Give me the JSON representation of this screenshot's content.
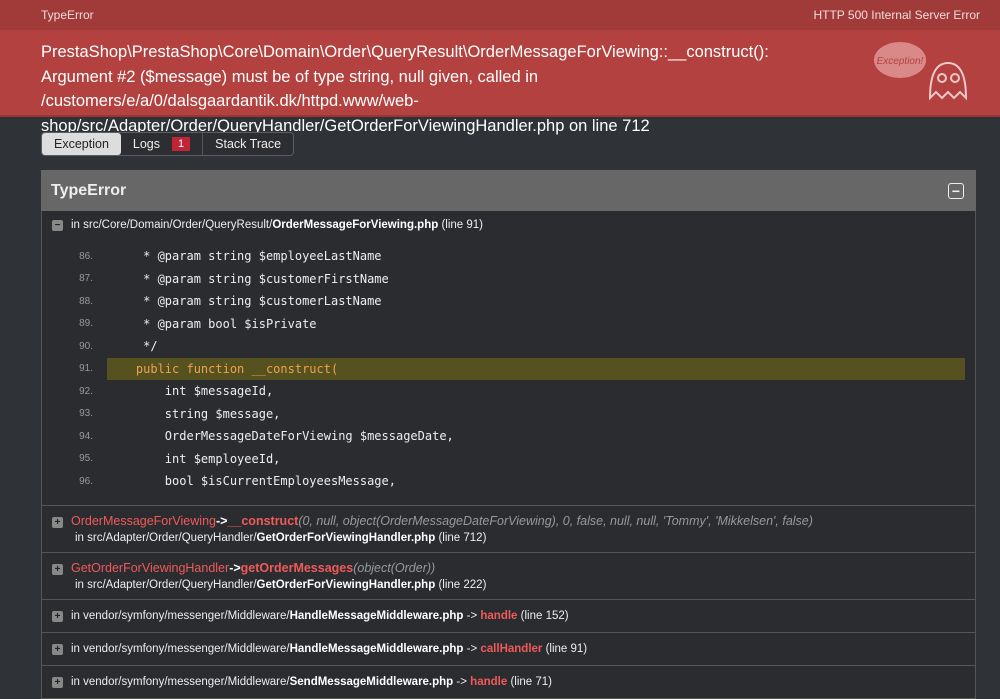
{
  "header": {
    "exception_class": "TypeError",
    "status": "HTTP 500",
    "status_text": "Internal Server Error"
  },
  "message": "PrestaShop\\PrestaShop\\Core\\Domain\\Order\\QueryResult\\OrderMessageForViewing::__construct(): Argument #2 ($message) must be of type string, null given, called in /customers/e/a/0/dalsgaardantik.dk/httpd.www/web-shop/src/Adapter/Order/QueryHandler/GetOrderForViewingHandler.php on line 712",
  "logo_text": "Exception!",
  "tabs": [
    {
      "label": "Exception"
    },
    {
      "label": "Logs",
      "badge": "1"
    },
    {
      "label": "Stack Trace"
    }
  ],
  "panel": {
    "title": "TypeError",
    "first": {
      "prefix": "in src/Core/Domain/Order/QueryResult/",
      "file": "OrderMessageForViewing.php",
      "line": "(line 91)"
    },
    "code": [
      {
        "n": "86.",
        "t": "     * @param string $employeeLastName"
      },
      {
        "n": "87.",
        "t": "     * @param string $customerFirstName"
      },
      {
        "n": "88.",
        "t": "     * @param string $customerLastName"
      },
      {
        "n": "89.",
        "t": "     * @param bool $isPrivate"
      },
      {
        "n": "90.",
        "t": "     */"
      },
      {
        "n": "91.",
        "t": "    public function __construct("
      },
      {
        "n": "92.",
        "t": "        int $messageId,"
      },
      {
        "n": "93.",
        "t": "        string $message,"
      },
      {
        "n": "94.",
        "t": "        OrderMessageDateForViewing $messageDate,"
      },
      {
        "n": "95.",
        "t": "        int $employeeId,"
      },
      {
        "n": "96.",
        "t": "        bool $isCurrentEmployeesMessage,"
      }
    ],
    "traces": [
      {
        "cls": "OrderMessageForViewing",
        "arrow": "->",
        "fn": "__construct",
        "args": "(0, null, object(OrderMessageDateForViewing), 0, false, null, null, 'Tommy', 'Mikkelsen', false)",
        "prefix": "in src/Adapter/Order/QueryHandler/",
        "file": "GetOrderForViewingHandler.php",
        "line": "(line 712)"
      },
      {
        "cls": "GetOrderForViewingHandler",
        "arrow": "->",
        "fn": "getOrderMessages",
        "args": "(object(Order))",
        "prefix": "in src/Adapter/Order/QueryHandler/",
        "file": "GetOrderForViewingHandler.php",
        "line": "(line 222)"
      }
    ],
    "vendor": [
      {
        "prefix": "in vendor/symfony/messenger/Middleware/",
        "file": "HandleMessageMiddleware.php",
        "arrow": "->",
        "fn": "handle",
        "line": "(line 152)"
      },
      {
        "prefix": "in vendor/symfony/messenger/Middleware/",
        "file": "HandleMessageMiddleware.php",
        "arrow": "->",
        "fn": "callHandler",
        "line": "(line 91)"
      },
      {
        "prefix": "in vendor/symfony/messenger/Middleware/",
        "file": "SendMessageMiddleware.php",
        "arrow": "->",
        "fn": "handle",
        "line": "(line 71)"
      }
    ]
  }
}
